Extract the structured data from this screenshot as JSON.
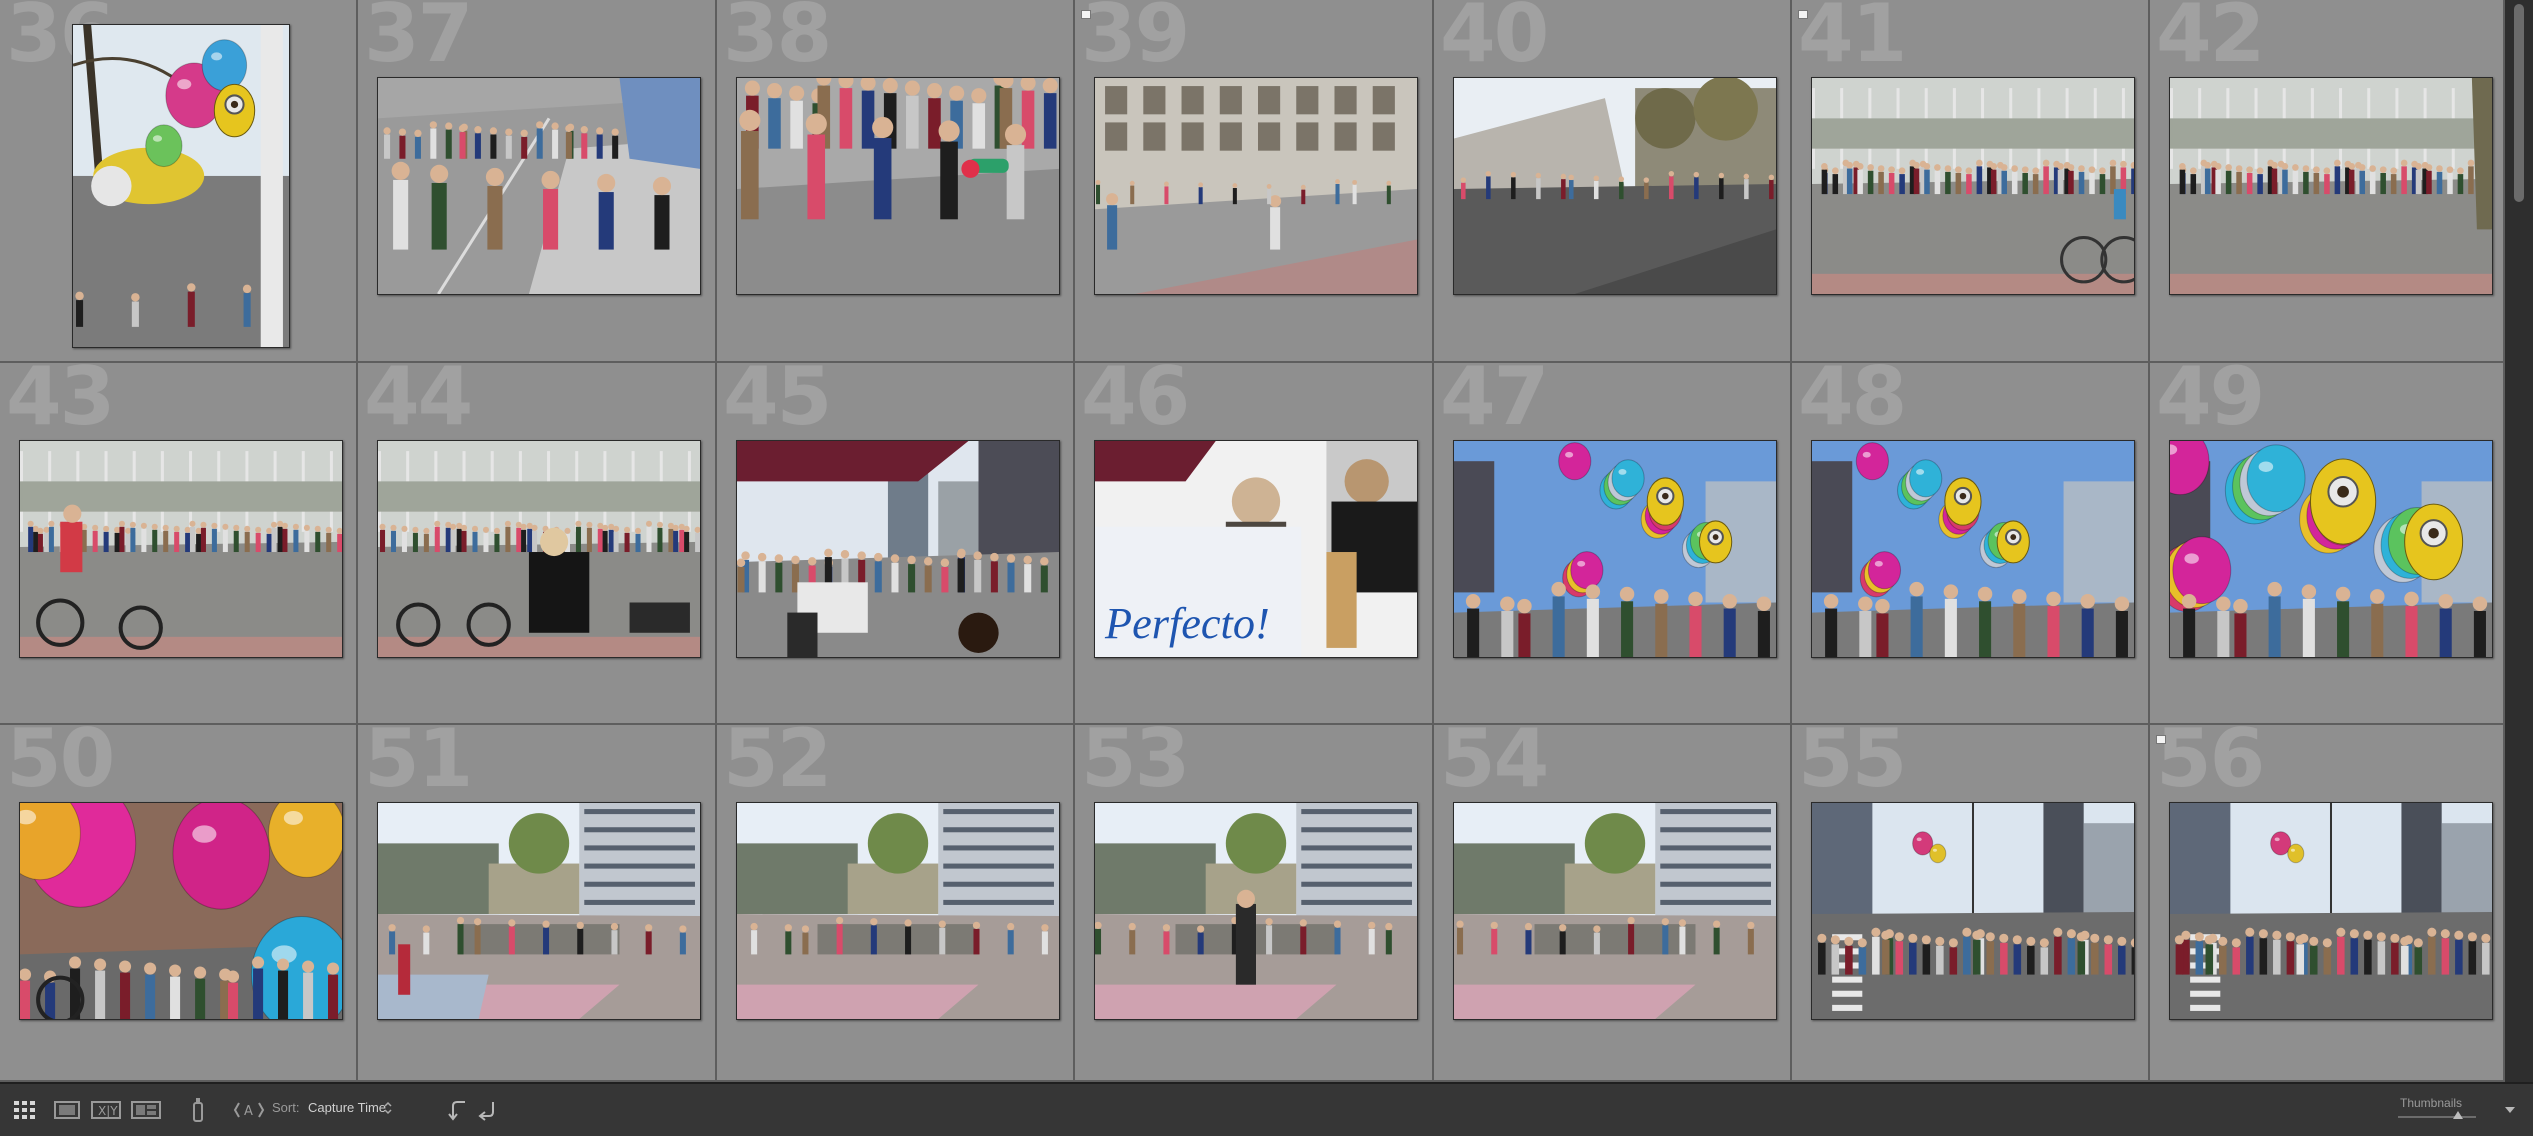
{
  "grid": {
    "cells": [
      {
        "num": "36",
        "thumb": "balloon-portrait",
        "flag": false
      },
      {
        "num": "37",
        "thumb": "crowd-street-1",
        "flag": false
      },
      {
        "num": "38",
        "thumb": "crowd-street-2",
        "flag": false
      },
      {
        "num": "39",
        "thumb": "building-street",
        "flag": true
      },
      {
        "num": "40",
        "thumb": "plaza-trees",
        "flag": false
      },
      {
        "num": "41",
        "thumb": "crowd-line-bike",
        "flag": true
      },
      {
        "num": "42",
        "thumb": "crowd-line",
        "flag": false
      },
      {
        "num": "43",
        "thumb": "cyclists-1",
        "flag": false
      },
      {
        "num": "44",
        "thumb": "cyclists-2",
        "flag": false
      },
      {
        "num": "45",
        "thumb": "street-city",
        "flag": false
      },
      {
        "num": "46",
        "thumb": "ice-cream-stand",
        "flag": false
      },
      {
        "num": "47",
        "thumb": "balloons-1",
        "flag": false
      },
      {
        "num": "48",
        "thumb": "balloons-2",
        "flag": false
      },
      {
        "num": "49",
        "thumb": "balloons-3",
        "flag": false
      },
      {
        "num": "50",
        "thumb": "balloons-close",
        "flag": false
      },
      {
        "num": "51",
        "thumb": "square-1",
        "flag": false
      },
      {
        "num": "52",
        "thumb": "square-2",
        "flag": false
      },
      {
        "num": "53",
        "thumb": "square-3",
        "flag": false
      },
      {
        "num": "54",
        "thumb": "square-4",
        "flag": false
      },
      {
        "num": "55",
        "thumb": "parade-1",
        "flag": false
      },
      {
        "num": "56",
        "thumb": "parade-2",
        "flag": true
      }
    ]
  },
  "toolbar": {
    "sort_label": "Sort:",
    "sort_value": "Capture Time",
    "thumbnails_label": "Thumbnails",
    "icons": [
      "grid-view-icon",
      "loupe-view-icon",
      "compare-view-icon",
      "survey-view-icon",
      "spray-can-icon",
      "rotate-icon",
      "rotate-left-icon",
      "rotate-right-icon",
      "chevron-down-icon"
    ]
  },
  "colors": {
    "cell_bg": "#8f8f8f",
    "grid_line": "#595959",
    "toolbar_bg": "#363636",
    "number_color": "#a1a1a1"
  }
}
